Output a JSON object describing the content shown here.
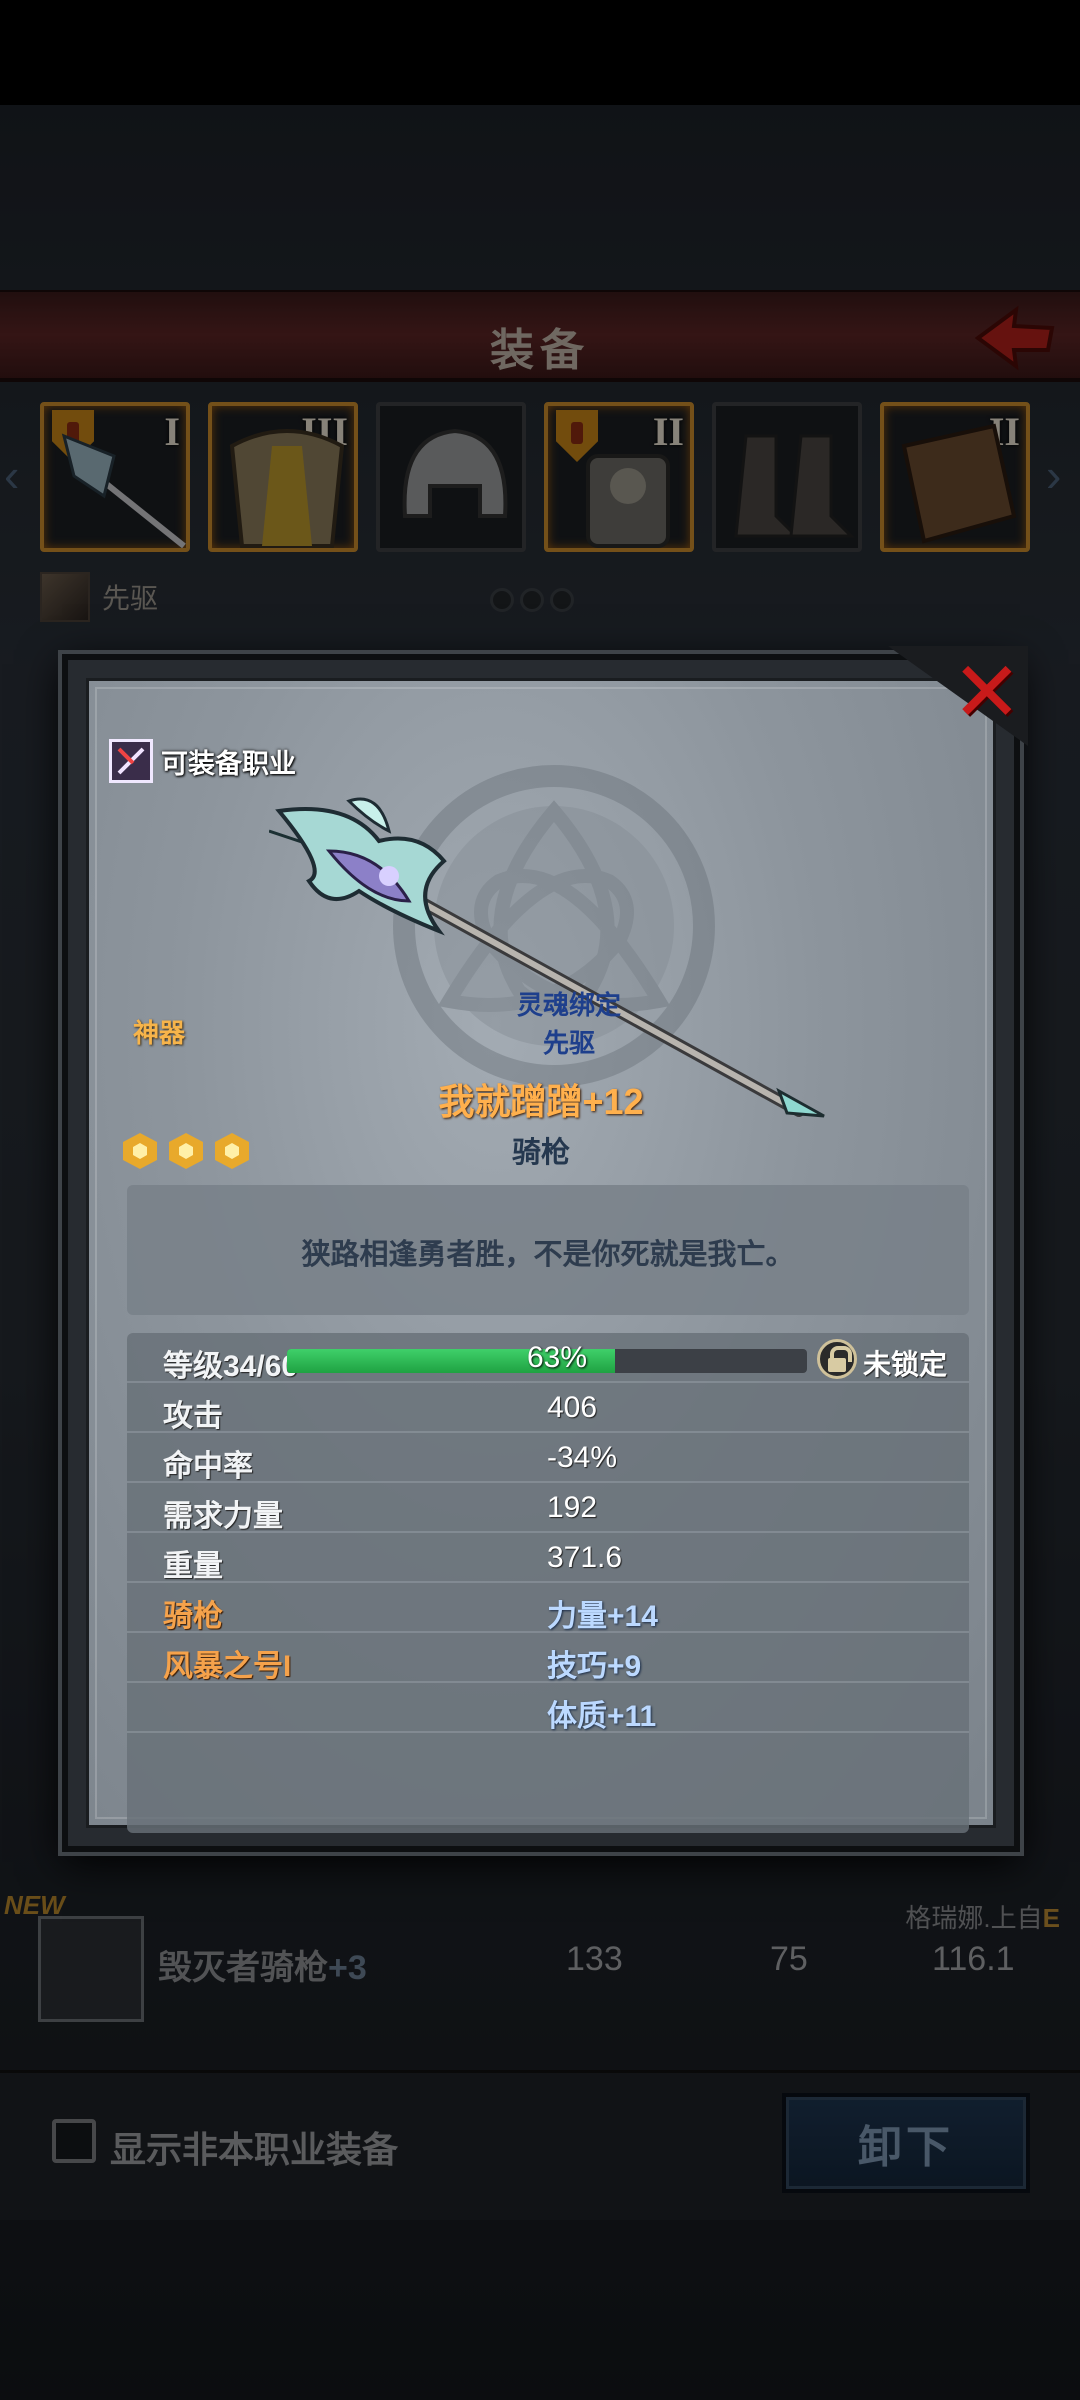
{
  "header": {
    "title": "装备"
  },
  "slots": [
    {
      "numeral": "I"
    },
    {
      "numeral": "III"
    },
    {
      "numeral": ""
    },
    {
      "numeral": "II"
    },
    {
      "numeral": ""
    },
    {
      "numeral": "II"
    }
  ],
  "character": {
    "class_name": "先驱"
  },
  "background_list": {
    "new_label": "NEW",
    "visible_item": {
      "name": "毁灭者骑枪",
      "plus": "+3",
      "attack": "133",
      "hit": "75",
      "weight": "116.1",
      "owner": "格瑞娜.上自",
      "owner_grade": "E"
    }
  },
  "bottom": {
    "show_nonclass_label": "显示非本职业装备",
    "unequip_label": "卸下"
  },
  "item": {
    "equip_class_label": "可装备职业",
    "rarity": "神器",
    "soulbound": "灵魂绑定",
    "bound_to": "先驱",
    "name": "我就蹭蹭",
    "enhance": "+12",
    "type": "骑枪",
    "stars": 3,
    "description": "狭路相逢勇者胜，不是你死就是我亡。",
    "level_label": "等级34/60",
    "level_progress": 0.63,
    "level_percent": "63%",
    "lock_label": "未锁定",
    "stats": [
      {
        "label": "攻击",
        "value": "406"
      },
      {
        "label": "命中率",
        "value": "-34%"
      },
      {
        "label": "需求力量",
        "value": "192"
      },
      {
        "label": "重量",
        "value": "371.6"
      }
    ],
    "bonus_rows": [
      {
        "skill": "骑枪",
        "bonus": "力量+14"
      },
      {
        "skill": "风暴之号I",
        "bonus": "技巧+9"
      },
      {
        "skill": "",
        "bonus": "体质+11"
      }
    ]
  },
  "colors": {
    "rarity": "#f7b44a",
    "item_name": "#f07a22",
    "bonus": "#bcd9ff",
    "level_fill": "#1fa242",
    "close": "#c81a1a"
  }
}
